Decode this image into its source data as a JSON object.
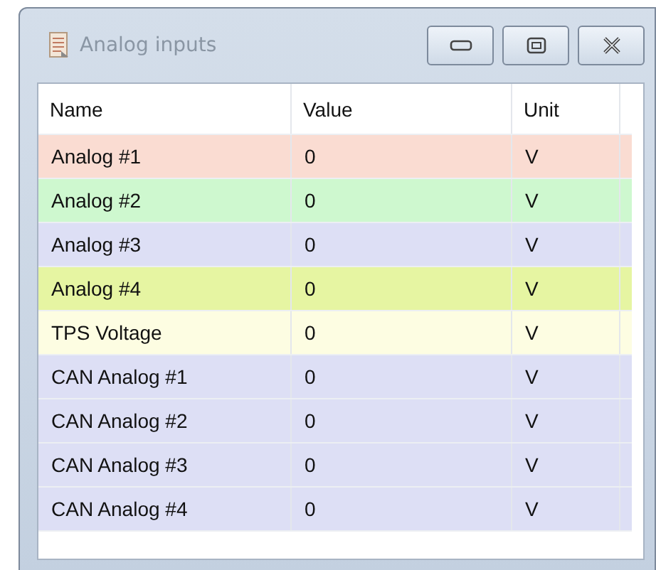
{
  "window": {
    "title": "Analog inputs"
  },
  "table": {
    "columns": [
      "Name",
      "Value",
      "Unit"
    ],
    "rows": [
      {
        "name": "Analog #1",
        "value": "0",
        "unit": "V",
        "color": "#fadcd2"
      },
      {
        "name": "Analog #2",
        "value": "0",
        "unit": "V",
        "color": "#cef8cf"
      },
      {
        "name": "Analog #3",
        "value": "0",
        "unit": "V",
        "color": "#dddff5"
      },
      {
        "name": "Analog #4",
        "value": "0",
        "unit": "V",
        "color": "#e6f5a2"
      },
      {
        "name": "TPS Voltage",
        "value": "0",
        "unit": "V",
        "color": "#fdfde2"
      },
      {
        "name": "CAN Analog #1",
        "value": "0",
        "unit": "V",
        "color": "#dddff5"
      },
      {
        "name": "CAN Analog #2",
        "value": "0",
        "unit": "V",
        "color": "#dddff5"
      },
      {
        "name": "CAN Analog #3",
        "value": "0",
        "unit": "V",
        "color": "#dddff5"
      },
      {
        "name": "CAN Analog #4",
        "value": "0",
        "unit": "V",
        "color": "#dddff5"
      }
    ]
  }
}
